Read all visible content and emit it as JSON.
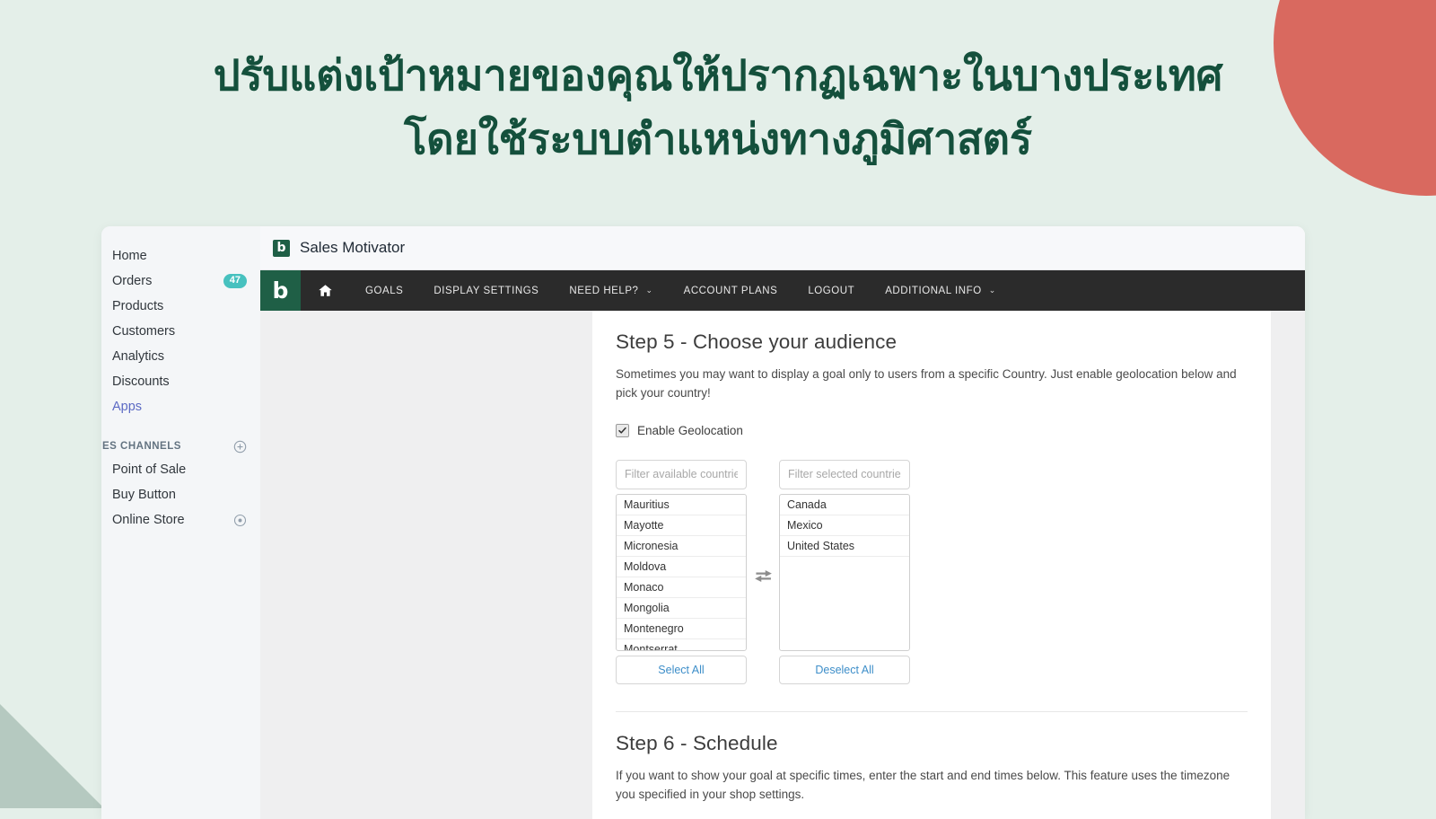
{
  "headline": {
    "line1": "ปรับแต่งเป้าหมายของคุณให้ปรากฏเฉพาะในบางประเทศ",
    "line2": "โดยใช้ระบบตำแหน่งทางภูมิศาสตร์"
  },
  "colors": {
    "page_background": "#e4efe9",
    "headline_text": "#14503c",
    "deco_circle": "#d9695f",
    "deco_triangle": "#b5c9c0",
    "brand_green": "#1f5f46",
    "nav_dark": "#2b2b2b",
    "badge_teal": "#47c1bf",
    "link_blue": "#3d8ec9",
    "active_nav": "#5c6ac4"
  },
  "sidebar": {
    "items": [
      {
        "label": "Home",
        "badge": null,
        "active": false
      },
      {
        "label": "Orders",
        "badge": "47",
        "active": false
      },
      {
        "label": "Products",
        "badge": null,
        "active": false
      },
      {
        "label": "Customers",
        "badge": null,
        "active": false
      },
      {
        "label": "Analytics",
        "badge": null,
        "active": false
      },
      {
        "label": "Discounts",
        "badge": null,
        "active": false
      },
      {
        "label": "Apps",
        "badge": null,
        "active": true
      }
    ],
    "section": {
      "label": "ES CHANNELS",
      "add_icon": "circle-plus-icon"
    },
    "channels": [
      {
        "label": "Point of Sale",
        "icon": null
      },
      {
        "label": "Buy Button",
        "icon": null
      },
      {
        "label": "Online Store",
        "icon": "eye-icon"
      }
    ]
  },
  "embedded_app": {
    "logo_letter": "b",
    "title": "Sales Motivator"
  },
  "app_nav": {
    "brand_letter": "b",
    "items": [
      {
        "label": "",
        "icon": "home-icon",
        "caret": false
      },
      {
        "label": "GOALS",
        "icon": null,
        "caret": false
      },
      {
        "label": "DISPLAY SETTINGS",
        "icon": null,
        "caret": false
      },
      {
        "label": "NEED HELP?",
        "icon": null,
        "caret": true
      },
      {
        "label": "ACCOUNT PLANS",
        "icon": null,
        "caret": false
      },
      {
        "label": "LOGOUT",
        "icon": null,
        "caret": false
      },
      {
        "label": "ADDITIONAL INFO",
        "icon": null,
        "caret": true
      }
    ],
    "caret_glyph": "⌄"
  },
  "step5": {
    "title": "Step 5 - Choose your audience",
    "description": "Sometimes you may want to display a goal only to users from a specific Country. Just enable geolocation below and pick your country!",
    "geolocation": {
      "label": "Enable Geolocation",
      "checked": true
    },
    "available": {
      "filter_placeholder": "Filter available countries",
      "filter_value": "",
      "options": [
        "Mauritius",
        "Mayotte",
        "Micronesia",
        "Moldova",
        "Monaco",
        "Mongolia",
        "Montenegro",
        "Montserrat"
      ],
      "button_label": "Select All"
    },
    "selected": {
      "filter_placeholder": "Filter selected countries",
      "filter_value": "",
      "options": [
        "Canada",
        "Mexico",
        "United States"
      ],
      "button_label": "Deselect All"
    },
    "swap_icon": "swap-arrows-icon"
  },
  "step6": {
    "title": "Step 6 - Schedule",
    "description": "If you want to show your goal at specific times, enter the start and end times below. This feature uses the timezone you specified in your shop settings."
  }
}
